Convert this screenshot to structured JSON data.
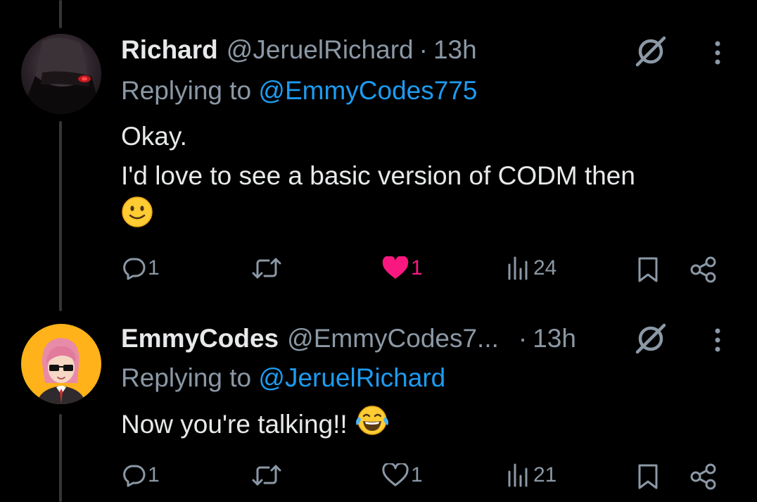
{
  "tweets": [
    {
      "name": "Richard",
      "handle": "@JeruelRichard",
      "separator": "·",
      "time": "13h",
      "replying_prefix": "Replying to",
      "replying_to": "@EmmyCodes775",
      "text_lines": [
        "Okay.",
        "I'd love to see a basic version of CODM then"
      ],
      "emoji": "slightly-smiling-face",
      "actions": {
        "replies": "1",
        "retweets": "",
        "likes": "1",
        "views": "24",
        "liked": true
      }
    },
    {
      "name": "EmmyCodes",
      "handle": "@EmmyCodes7...",
      "separator": "·",
      "time": "13h",
      "replying_prefix": "Replying to",
      "replying_to": "@JeruelRichard",
      "text_lines": [
        "Now you're talking!!"
      ],
      "emoji": "face-with-tears-of-joy",
      "actions": {
        "replies": "1",
        "retweets": "",
        "likes": "1",
        "views": "21",
        "liked": false
      }
    }
  ],
  "colors": {
    "background": "#000000",
    "text": "#e7e9ea",
    "secondary": "#8b98a5",
    "mention": "#1d9bf0",
    "like": "#f91880"
  }
}
